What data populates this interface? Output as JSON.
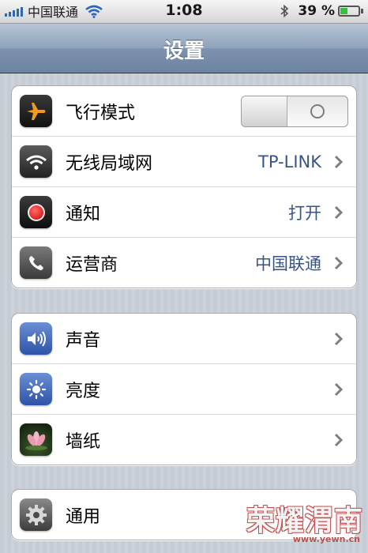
{
  "status_bar": {
    "carrier": "中国联通",
    "time": "1:08",
    "battery_percent": "39 %",
    "battery_level": 0.39
  },
  "nav_bar": {
    "title": "设置"
  },
  "groups": [
    {
      "rows": [
        {
          "label": "飞行模式",
          "icon": "airplane-icon",
          "toggle": "off"
        },
        {
          "label": "无线局域网",
          "value": "TP-LINK",
          "icon": "wifi-icon"
        },
        {
          "label": "通知",
          "value": "打开",
          "icon": "notifications-icon"
        },
        {
          "label": "运营商",
          "value": "中国联通",
          "icon": "phone-icon"
        }
      ]
    },
    {
      "rows": [
        {
          "label": "声音",
          "icon": "speaker-icon"
        },
        {
          "label": "亮度",
          "icon": "brightness-icon"
        },
        {
          "label": "墙纸",
          "icon": "lotus-wallpaper-icon"
        }
      ]
    },
    {
      "rows": [
        {
          "label": "通用",
          "icon": "gear-icon"
        }
      ]
    }
  ],
  "watermark": {
    "text": "荣耀渭南",
    "url": "www.yewn.cn"
  },
  "colors": {
    "value_text": "#385487",
    "nav_bar": "#7c92ae",
    "background": "#c5ccd4"
  }
}
